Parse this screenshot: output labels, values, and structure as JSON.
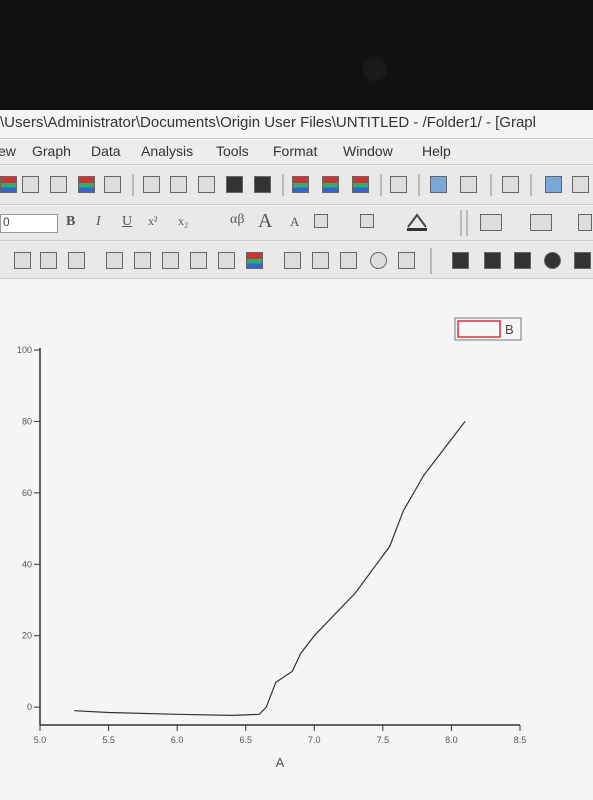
{
  "window": {
    "title": "\\Users\\Administrator\\Documents\\Origin User Files\\UNTITLED - /Folder1/ - [Grapl"
  },
  "menu": {
    "items": [
      "ew",
      "Graph",
      "Data",
      "Analysis",
      "Tools",
      "Format",
      "Window",
      "Help"
    ]
  },
  "toolbar2": {
    "font_size_value": "0",
    "bold": "B",
    "italic": "I",
    "underline": "U",
    "superscript": "x²",
    "subscript": "x₂",
    "greek": "αβ",
    "grow": "A",
    "shrink": "A"
  },
  "chart_data": {
    "type": "line",
    "title": "",
    "xlabel": "A",
    "ylabel": "",
    "xlim": [
      5.0,
      8.5
    ],
    "ylim": [
      -5,
      100
    ],
    "x_ticks": [
      "5.0",
      "5.5",
      "6.0",
      "6.5",
      "7.0",
      "7.5",
      "8.0",
      "8.5"
    ],
    "y_ticks": [
      "0",
      "20",
      "40",
      "60",
      "80",
      "100"
    ],
    "legend": {
      "label": "B",
      "placement": "top-right",
      "swatch_color": "#e0303a"
    },
    "series": [
      {
        "name": "B",
        "color": "#333333",
        "x": [
          5.25,
          5.5,
          6.0,
          6.4,
          6.6,
          6.65,
          6.68,
          6.7,
          6.72,
          6.76,
          6.84,
          6.9,
          7.0,
          7.3,
          7.55,
          7.65,
          7.8,
          8.1
        ],
        "y": [
          -1,
          -1.5,
          -2,
          -2.3,
          -2,
          0,
          3,
          5,
          7,
          8,
          10,
          15,
          20,
          32,
          45,
          55,
          65,
          80
        ]
      }
    ]
  }
}
